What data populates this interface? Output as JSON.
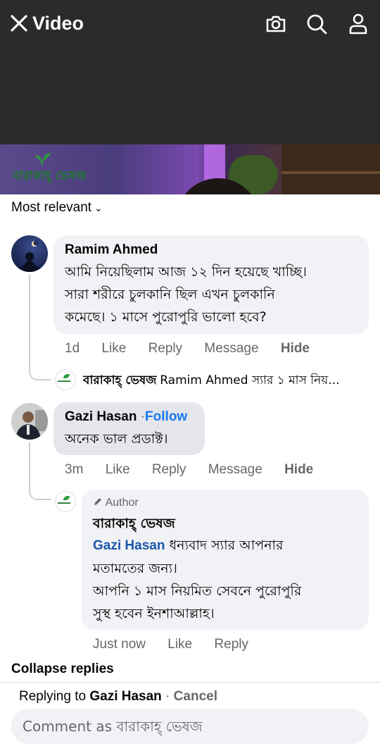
{
  "header": {
    "title": "Video",
    "close_icon": "close-icon",
    "camera_icon": "camera-icon",
    "search_icon": "search-icon",
    "profile_icon": "profile-icon"
  },
  "video": {
    "logo_text": "বারাকাহ্ ভেষজ"
  },
  "sort": {
    "label": "Most relevant",
    "icon": "chevron-down-icon"
  },
  "comments": [
    {
      "author": "Ramim Ahmed",
      "text_lines": [
        "আমি নিয়েছিলাম আজ ১২ দিন হয়েছে খাচ্ছি।",
        "সারা শরীরে চুলকানি ছিল এখন চুলকানি",
        "কমেছে। ১ মাসে পুরোপুরি ভালো হবে?"
      ],
      "time": "1d",
      "like": "Like",
      "reply": "Reply",
      "message": "Message",
      "hide": "Hide",
      "reply_preview": {
        "name": "বারাকাহ্ ভেষজ",
        "text": "Ramim Ahmed স্যার ১ মাস নিয়..."
      }
    },
    {
      "author": "Gazi Hasan",
      "follow": "Follow",
      "separator": "·",
      "text": "অনেক ভাল প্রডাক্ট।",
      "time": "3m",
      "like": "Like",
      "reply": "Reply",
      "message": "Message",
      "hide": "Hide",
      "author_reply": {
        "badge": "Author",
        "name": "বারাকাহ্ ভেষজ",
        "mention": "Gazi Hasan",
        "line1_rest": " ধন্যবাদ স্যার আপনার",
        "line2": "মতামতের জন্য।",
        "line3": "আপনি ১ মাস নিয়মিত সেবনে পুরোপুরি",
        "line4": "সুস্থ হবেন ইনশাআল্লাহ।",
        "time": "Just now",
        "like": "Like",
        "reply": "Reply"
      }
    }
  ],
  "collapse_label": "Collapse replies",
  "replying": {
    "prefix": "Replying to ",
    "name": "Gazi Hasan",
    "separator": " · ",
    "cancel": "Cancel"
  },
  "composer": {
    "placeholder": "Comment as বারাকাহ্ ভেষজ"
  }
}
